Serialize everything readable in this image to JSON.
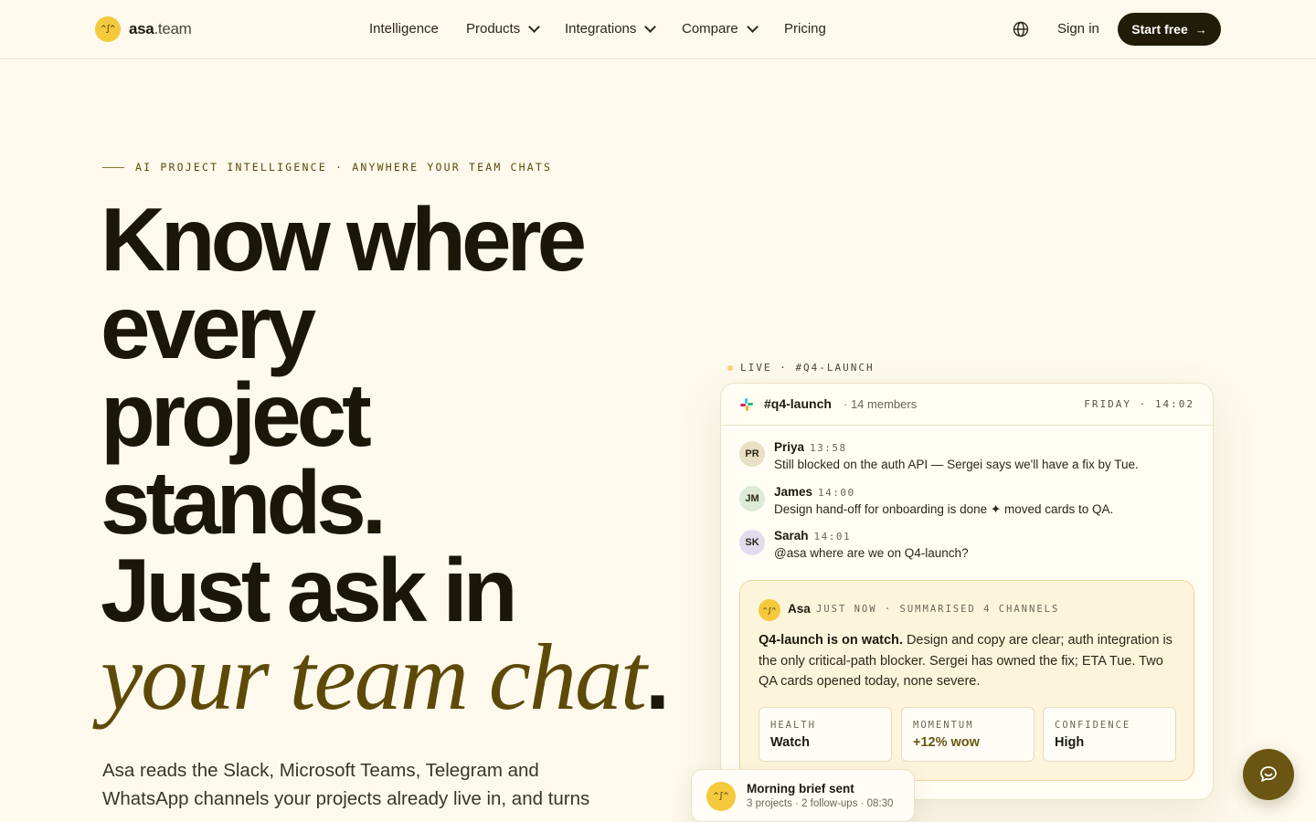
{
  "nav": {
    "brand_face": "^ʃ^",
    "brand_bold": "asa",
    "brand_rest": ".team",
    "items": [
      {
        "label": "Intelligence"
      },
      {
        "label": "Products"
      },
      {
        "label": "Integrations"
      },
      {
        "label": "Compare"
      },
      {
        "label": "Pricing"
      }
    ],
    "signin": "Sign in",
    "cta": "Start free",
    "cta_arrow": "→"
  },
  "hero": {
    "eyebrow": "AI PROJECT INTELLIGENCE · ANYWHERE YOUR TEAM CHATS",
    "line1": "Know where",
    "line2": "every",
    "line3": "project",
    "line4": "stands.",
    "line5": "Just ask in",
    "italic": "your team chat",
    "period": ".",
    "lede": "Asa reads the Slack, Microsoft Teams, Telegram and WhatsApp channels your projects already live in, and turns"
  },
  "preview": {
    "live_label": "LIVE · #Q4-LAUNCH",
    "channel": "#q4-launch",
    "members": "· 14 members",
    "when": "FRIDAY · 14:02",
    "messages": [
      {
        "initials": "PR",
        "name": "Priya",
        "time": "13:58",
        "text": "Still blocked on the auth API — Sergei says we'll have a fix by Tue.",
        "color": "#e9dfc4"
      },
      {
        "initials": "JM",
        "name": "James",
        "time": "14:00",
        "text": "Design hand-off for onboarding is done ✦ moved cards to QA.",
        "color": "#dcebd6"
      },
      {
        "initials": "SK",
        "name": "Sarah",
        "time": "14:01",
        "text": "@asa where are we on Q4-launch?",
        "color": "#e3dcef"
      }
    ],
    "asa": {
      "face": "^ʃ^",
      "name": "Asa",
      "meta": "JUST NOW · SUMMARISED 4 CHANNELS",
      "lead": "Q4-launch is on watch.",
      "body": " Design and copy are clear; auth integration is the only critical-path blocker. Sergei has owned the fix; ETA Tue. Two QA cards opened today, none severe.",
      "stats": [
        {
          "key": "HEALTH",
          "value": "Watch"
        },
        {
          "key": "MOMENTUM",
          "value": "+12% wow"
        },
        {
          "key": "CONFIDENCE",
          "value": "High"
        }
      ]
    }
  },
  "toast": {
    "face": "^ʃ^",
    "title": "Morning brief sent",
    "sub": "3 projects · 2 follow-ups · 08:30"
  },
  "icons": {
    "globe": "globe-icon",
    "chat": "chat-bubble-icon",
    "slack": "slack-icon"
  }
}
